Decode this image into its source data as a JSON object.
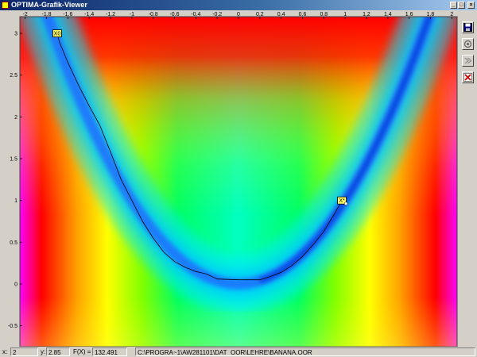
{
  "window": {
    "title": "OPTIMA-Grafik-Viewer",
    "minimize_glyph": "_",
    "maximize_glyph": "□",
    "close_glyph": "×"
  },
  "plot": {
    "x_ticks": [
      "-2",
      "-1.8",
      "-1.6",
      "-1.4",
      "-1.2",
      "-1",
      "-0.8",
      "-0.6",
      "-0.4",
      "-0.2",
      "0",
      "0.2",
      "0.4",
      "0.6",
      "0.8",
      "1",
      "1.2",
      "1.4",
      "1.6",
      "1.8",
      "2"
    ],
    "y_ticks": [
      "3",
      "2.5",
      "2",
      "1.5",
      "1",
      "0.5",
      "0",
      "-0.5"
    ],
    "start_marker": {
      "label": "X0",
      "x": -1.7,
      "y": 3.0
    },
    "end_marker": {
      "label": "X*",
      "x": 0.97,
      "y": 1.0
    },
    "path": [
      [
        -1.7,
        3.0
      ],
      [
        -1.68,
        2.9
      ],
      [
        -1.6,
        2.65
      ],
      [
        -1.5,
        2.38
      ],
      [
        -1.4,
        2.13
      ],
      [
        -1.3,
        1.9
      ],
      [
        -1.2,
        1.58
      ],
      [
        -1.1,
        1.25
      ],
      [
        -1.0,
        1.0
      ],
      [
        -0.9,
        0.75
      ],
      [
        -0.8,
        0.55
      ],
      [
        -0.7,
        0.38
      ],
      [
        -0.6,
        0.27
      ],
      [
        -0.5,
        0.2
      ],
      [
        -0.4,
        0.15
      ],
      [
        -0.3,
        0.12
      ],
      [
        -0.2,
        0.06
      ],
      [
        0.0,
        0.05
      ],
      [
        0.2,
        0.05
      ],
      [
        0.3,
        0.09
      ],
      [
        0.4,
        0.14
      ],
      [
        0.5,
        0.22
      ],
      [
        0.6,
        0.33
      ],
      [
        0.7,
        0.47
      ],
      [
        0.8,
        0.63
      ],
      [
        0.9,
        0.84
      ],
      [
        0.97,
        1.0
      ]
    ],
    "valley_color": "#1e6cff",
    "valley_deep_color": "#003cd8"
  },
  "toolbar": {
    "save_icon": "floppy-disk-icon",
    "options_icon": "settings-icon",
    "step_icon": "step-icon",
    "close_icon": "close-icon"
  },
  "status": {
    "x_label": "x:",
    "x_value": "2",
    "y_label": "y:",
    "y_value": "2.85",
    "f_label": "F(X) =",
    "f_value": "132.491",
    "file_path": "C:\\PROGRA~1\\AW281101\\DAT_OOR\\LEHRE\\BANANA.OOR"
  }
}
